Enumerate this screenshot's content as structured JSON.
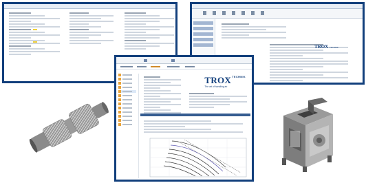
{
  "brand": {
    "name": "TROX",
    "suffix": "TECHNIK",
    "tagline": "The art of handling air"
  },
  "colors": {
    "frame": "#123f7c",
    "accent": "#e8a33b",
    "curve": "#5d58b3"
  },
  "icons": [
    "toolbar-icon",
    "folder-icon",
    "cylindrical-fan-icon",
    "box-fan-icon"
  ]
}
